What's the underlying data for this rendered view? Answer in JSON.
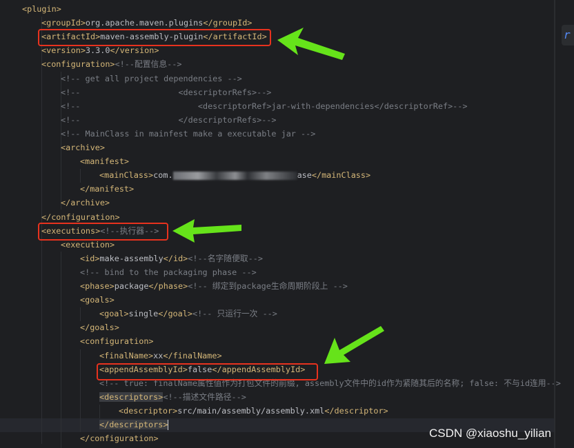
{
  "editor": {
    "language": "xml",
    "colors": {
      "background": "#1e1f22",
      "tag": "#d5b778",
      "text": "#bcbec4",
      "comment": "#7a7e85",
      "highlight_box": "#e8321e",
      "arrow": "#66e31a"
    },
    "lines": [
      {
        "indent": 0,
        "segs": [
          [
            "tag",
            "<plugin>"
          ]
        ]
      },
      {
        "indent": 1,
        "segs": [
          [
            "tag",
            "<groupId>"
          ],
          [
            "text",
            "org.apache.maven.plugins"
          ],
          [
            "tag",
            "</groupId>"
          ]
        ]
      },
      {
        "indent": 1,
        "boxed": true,
        "segs": [
          [
            "tag",
            "<artifactId>"
          ],
          [
            "text",
            "maven-assembly-plugin"
          ],
          [
            "tag",
            "</artifactId>"
          ]
        ]
      },
      {
        "indent": 1,
        "segs": [
          [
            "tag",
            "<version>"
          ],
          [
            "text",
            "3.3.0"
          ],
          [
            "tag",
            "</version>"
          ]
        ]
      },
      {
        "indent": 1,
        "segs": [
          [
            "tag",
            "<configuration>"
          ],
          [
            "comment",
            "<!--配置信息-->"
          ]
        ]
      },
      {
        "indent": 2,
        "segs": [
          [
            "comment",
            "<!-- get all project dependencies -->"
          ]
        ]
      },
      {
        "indent": 2,
        "segs": [
          [
            "comment",
            "<!--                    <descriptorRefs>-->"
          ]
        ]
      },
      {
        "indent": 2,
        "segs": [
          [
            "comment",
            "<!--                        <descriptorRef>jar-with-dependencies</descriptorRef>-->"
          ]
        ]
      },
      {
        "indent": 2,
        "segs": [
          [
            "comment",
            "<!--                    </descriptorRefs>-->"
          ]
        ]
      },
      {
        "indent": 2,
        "segs": [
          [
            "comment",
            "<!-- MainClass in mainfest make a executable jar -->"
          ]
        ]
      },
      {
        "indent": 2,
        "segs": [
          [
            "tag",
            "<archive>"
          ]
        ]
      },
      {
        "indent": 3,
        "segs": [
          [
            "tag",
            "<manifest>"
          ]
        ]
      },
      {
        "indent": 4,
        "segs": [
          [
            "tag",
            "<mainClass>"
          ],
          [
            "text",
            "com."
          ],
          [
            "redacted",
            ""
          ],
          [
            "text",
            "ase"
          ],
          [
            "tag",
            "</mainClass>"
          ]
        ]
      },
      {
        "indent": 3,
        "segs": [
          [
            "tag",
            "</manifest>"
          ]
        ]
      },
      {
        "indent": 2,
        "segs": [
          [
            "tag",
            "</archive>"
          ]
        ]
      },
      {
        "indent": 1,
        "segs": [
          [
            "tag",
            "</configuration>"
          ]
        ]
      },
      {
        "indent": 1,
        "boxed": true,
        "segs": [
          [
            "tag",
            "<executions>"
          ],
          [
            "comment",
            "<!--执行器-->"
          ]
        ]
      },
      {
        "indent": 2,
        "segs": [
          [
            "tag",
            "<execution>"
          ]
        ]
      },
      {
        "indent": 3,
        "segs": [
          [
            "tag",
            "<id>"
          ],
          [
            "text",
            "make-assembly"
          ],
          [
            "tag",
            "</id>"
          ],
          [
            "comment",
            "<!--名字随便取-->"
          ]
        ]
      },
      {
        "indent": 3,
        "segs": [
          [
            "comment",
            "<!-- bind to the packaging phase -->"
          ]
        ]
      },
      {
        "indent": 3,
        "segs": [
          [
            "tag",
            "<phase>"
          ],
          [
            "text",
            "package"
          ],
          [
            "tag",
            "</phase>"
          ],
          [
            "comment",
            "<!-- 绑定到package生命周期阶段上 -->"
          ]
        ]
      },
      {
        "indent": 3,
        "segs": [
          [
            "tag",
            "<goals>"
          ]
        ]
      },
      {
        "indent": 4,
        "segs": [
          [
            "tag",
            "<goal>"
          ],
          [
            "text",
            "single"
          ],
          [
            "tag",
            "</goal>"
          ],
          [
            "comment",
            "<!-- 只运行一次 -->"
          ]
        ]
      },
      {
        "indent": 3,
        "segs": [
          [
            "tag",
            "</goals>"
          ]
        ]
      },
      {
        "indent": 3,
        "segs": [
          [
            "tag",
            "<configuration>"
          ]
        ]
      },
      {
        "indent": 4,
        "segs": [
          [
            "tag",
            "<finalName>"
          ],
          [
            "text",
            "xx"
          ],
          [
            "tag",
            "</finalName>"
          ]
        ]
      },
      {
        "indent": 4,
        "boxed": true,
        "segs": [
          [
            "tag",
            "<appendAssemblyId>"
          ],
          [
            "text",
            "false"
          ],
          [
            "tag",
            "</appendAssemblyId>"
          ]
        ]
      },
      {
        "indent": 4,
        "segs": [
          [
            "comment",
            "<!-- true: finalName属性值作为打包文件的前缀, assembly文件中的id作为紧随其后的名称; false: 不与id连用-->"
          ]
        ]
      },
      {
        "indent": 4,
        "segs": [
          [
            "tag match",
            "<descriptors>"
          ],
          [
            "comment",
            "<!--描述文件路径-->"
          ]
        ]
      },
      {
        "indent": 5,
        "segs": [
          [
            "tag",
            "<descriptor>"
          ],
          [
            "text",
            "src/main/assembly/assembly.xml"
          ],
          [
            "tag",
            "</descriptor>"
          ]
        ]
      },
      {
        "indent": 4,
        "current": true,
        "segs": [
          [
            "tag match",
            "</descriptors>"
          ],
          [
            "cursor",
            ""
          ]
        ]
      },
      {
        "indent": 3,
        "segs": [
          [
            "tag",
            "</configuration>"
          ]
        ]
      }
    ]
  },
  "right_panel": {
    "glyph": "r"
  },
  "watermark": "CSDN @xiaoshu_yilian"
}
